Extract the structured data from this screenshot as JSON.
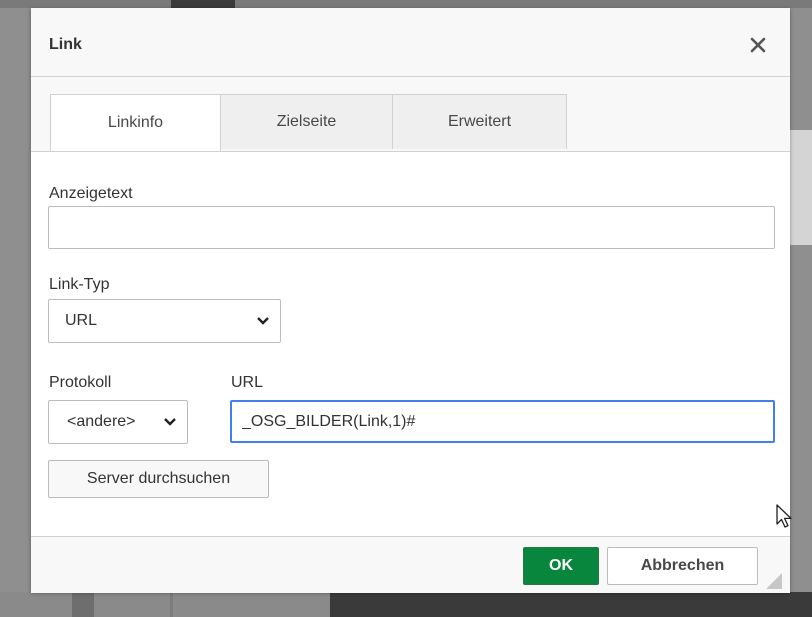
{
  "dialog": {
    "title": "Link",
    "close_icon": "close-icon"
  },
  "tabs": [
    {
      "label": "Linkinfo",
      "active": true
    },
    {
      "label": "Zielseite",
      "active": false
    },
    {
      "label": "Erweitert",
      "active": false
    }
  ],
  "form": {
    "display_text": {
      "label": "Anzeigetext",
      "value": ""
    },
    "link_type": {
      "label": "Link-Typ",
      "value": "URL"
    },
    "protocol": {
      "label": "Protokoll",
      "value": "<andere>"
    },
    "url": {
      "label": "URL",
      "value": "_OSG_BILDER(Link,1)#"
    },
    "browse_label": "Server durchsuchen"
  },
  "footer": {
    "ok_label": "OK",
    "cancel_label": "Abbrechen"
  },
  "colors": {
    "ok_button": "#09863e",
    "focus_border": "#427fed"
  }
}
